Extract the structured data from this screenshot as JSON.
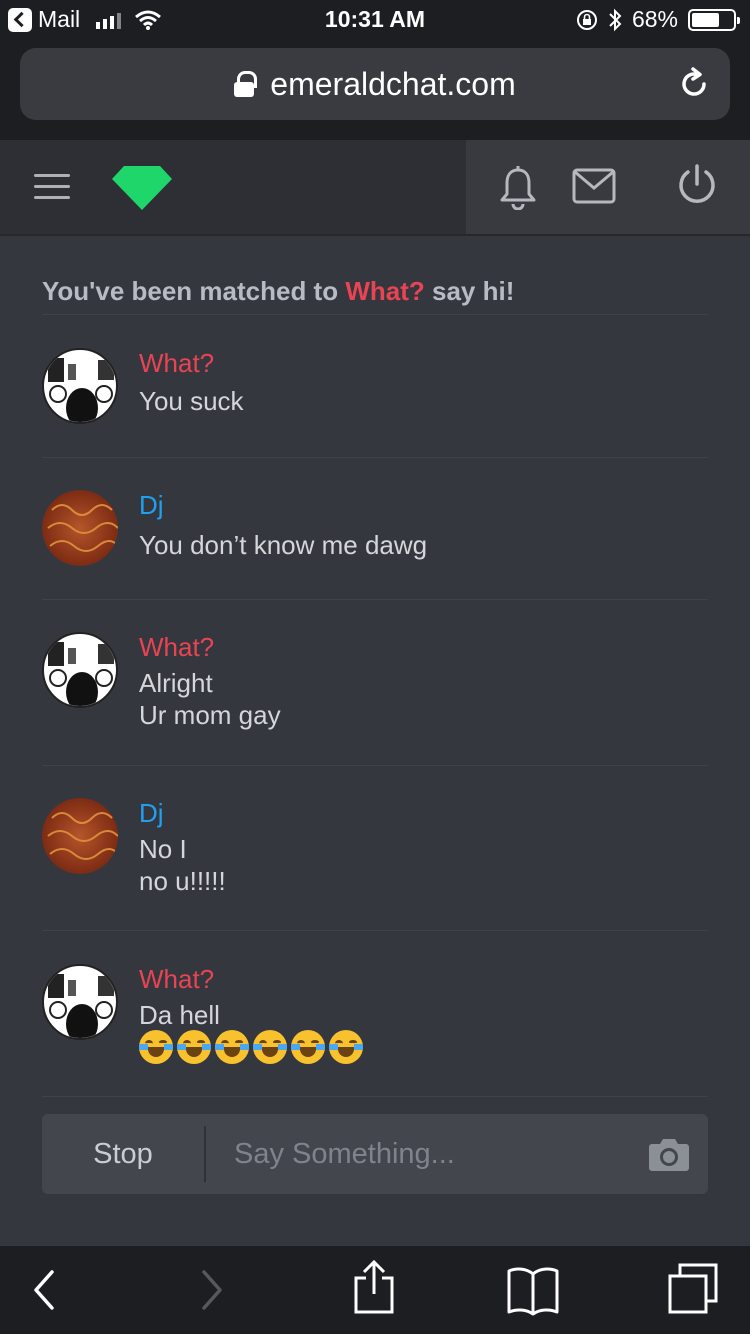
{
  "status_bar": {
    "back_app": "Mail",
    "time": "10:31 AM",
    "battery": "68%",
    "battery_level": 0.68
  },
  "browser": {
    "url": "emeraldchat.com"
  },
  "header": {
    "icons": [
      "menu-icon",
      "gem-logo-icon",
      "bell-icon",
      "mail-icon",
      "power-icon"
    ],
    "brand_color": "#1fd66a"
  },
  "chat": {
    "matched": {
      "prefix": "You've been matched to",
      "partner": "What?",
      "suffix": "say hi!"
    },
    "messages": [
      {
        "name": "What?",
        "lines": [
          "You suck"
        ]
      },
      {
        "name": "Dj",
        "lines": [
          "You don’t know me dawg"
        ]
      },
      {
        "name": "What?",
        "lines": [
          "Alright",
          "Ur mom gay"
        ]
      },
      {
        "name": "Dj",
        "lines": [
          "No I",
          "no u!!!!!"
        ]
      },
      {
        "name": "What?",
        "lines": [
          "Da hell"
        ],
        "emoji": [
          "😂",
          "😂",
          "😂",
          "😂",
          "😂",
          "😂"
        ]
      }
    ]
  },
  "composer": {
    "stop_label": "Stop",
    "placeholder": "Say Something..."
  },
  "colors": {
    "partner_name": "#e84453",
    "self_name": "#21a0ef",
    "background": "#34373e"
  }
}
